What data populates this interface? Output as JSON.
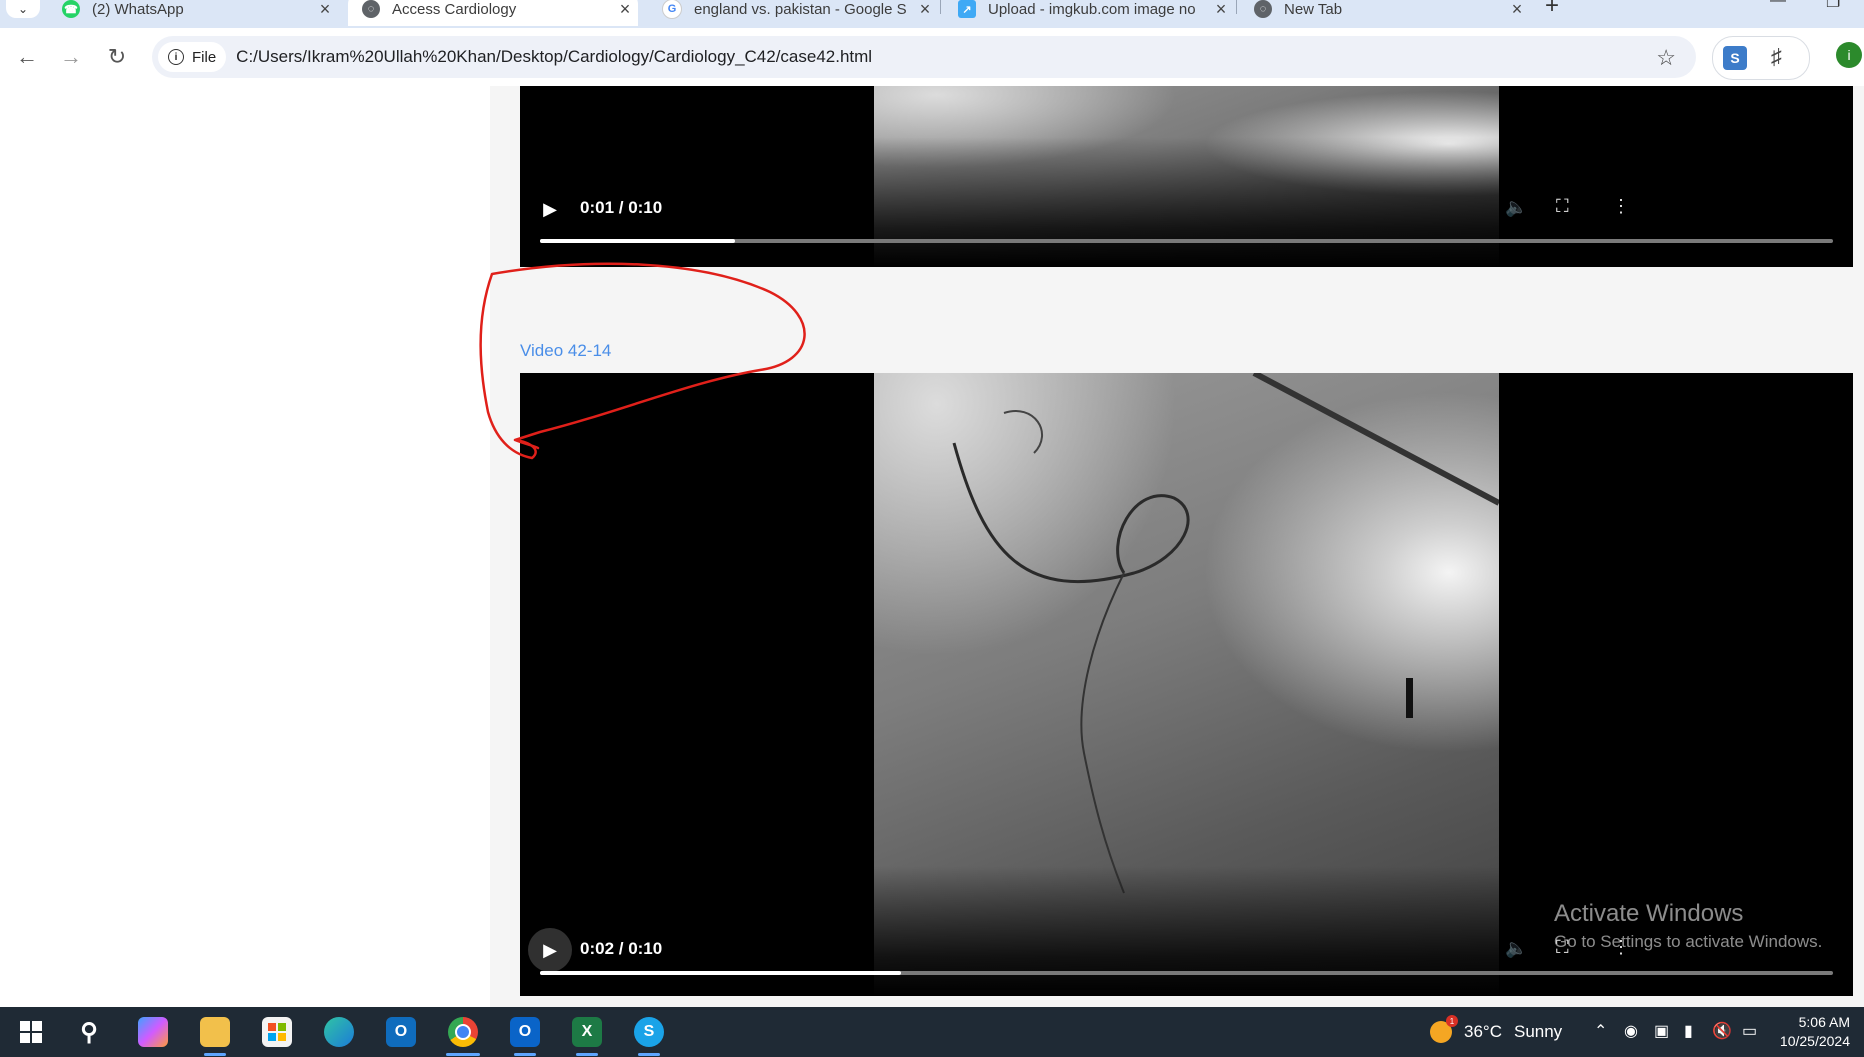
{
  "browser": {
    "tabs": [
      {
        "title": "(2) WhatsApp",
        "icon": "whatsapp-icon",
        "color": "#25d366",
        "active": false
      },
      {
        "title": "Access Cardiology",
        "icon": "globe-icon",
        "color": "#5f6368",
        "active": true
      },
      {
        "title": "england vs. pakistan - Google S",
        "icon": "google-icon",
        "color": "#4285f4",
        "active": false
      },
      {
        "title": "Upload - imgkub.com image no",
        "icon": "imgkub-icon",
        "color": "#3fa9f5",
        "active": false
      },
      {
        "title": "New Tab",
        "icon": "globe-icon",
        "color": "#5f6368",
        "active": false
      }
    ],
    "new_tab_symbol": "+",
    "close_symbol": "×",
    "file_chip": "File",
    "url": "C:/Users/Ikram%20Ullah%20Khan/Desktop/Cardiology/Cardiology_C42/case42.html",
    "profile_initial": "i",
    "extension_initial": "S"
  },
  "page": {
    "video_top": {
      "time": "0:01 / 0:10",
      "progress_fraction": 0.151
    },
    "caption": "Video 42-14",
    "video_bottom": {
      "time": "0:02 / 0:10",
      "progress_fraction": 0.279
    },
    "watermark": {
      "line1": "Activate Windows",
      "line2": "Go to Settings to activate Windows."
    }
  },
  "taskbar": {
    "apps": [
      {
        "name": "start-icon",
        "label": ""
      },
      {
        "name": "search-icon",
        "label": ""
      },
      {
        "name": "copilot-icon",
        "label": ""
      },
      {
        "name": "file-explorer-icon",
        "label": ""
      },
      {
        "name": "store-icon",
        "label": ""
      },
      {
        "name": "edge-icon",
        "label": ""
      },
      {
        "name": "outlook-new-icon",
        "label": "O"
      },
      {
        "name": "chrome-icon",
        "label": ""
      },
      {
        "name": "outlook-icon",
        "label": "O"
      },
      {
        "name": "excel-icon",
        "label": "X"
      },
      {
        "name": "skype-icon",
        "label": "S"
      }
    ],
    "weather": {
      "temp": "36°C",
      "condition": "Sunny",
      "badge": "1"
    },
    "clock": {
      "time": "5:06 AM",
      "date": "10/25/2024"
    }
  },
  "colors": {
    "accent_link": "#4a8ee8",
    "annotation_red": "#e0201a",
    "taskbar_bg": "#1f2a35"
  }
}
